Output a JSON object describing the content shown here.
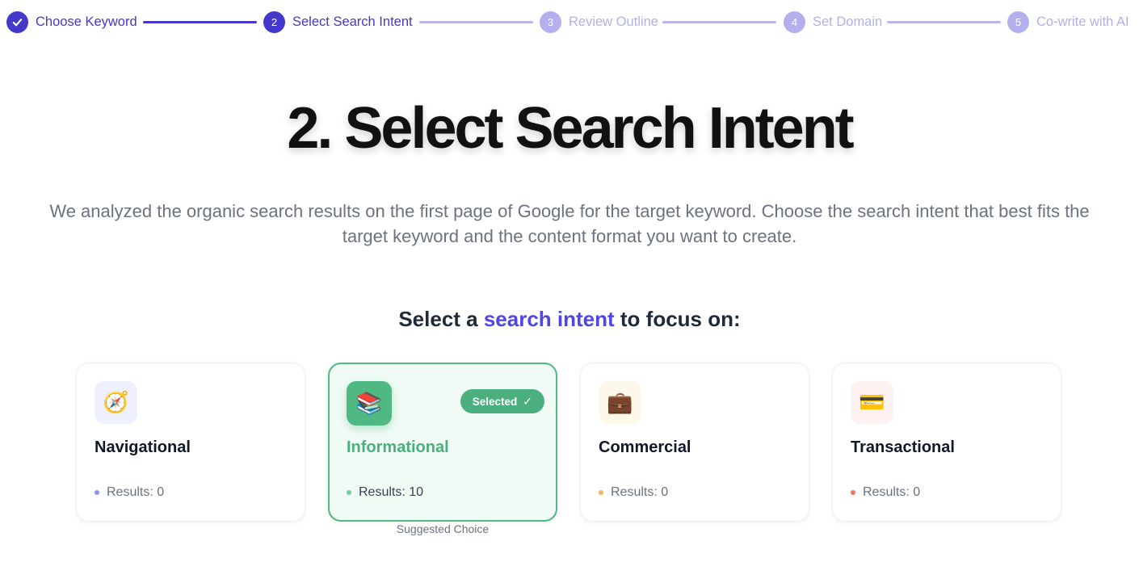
{
  "stepper": {
    "steps": [
      {
        "number": "✓",
        "label": "Choose Keyword",
        "state": "done"
      },
      {
        "number": "2",
        "label": "Select Search Intent",
        "state": "active"
      },
      {
        "number": "3",
        "label": "Review Outline",
        "state": "pending"
      },
      {
        "number": "4",
        "label": "Set Domain",
        "state": "pending"
      },
      {
        "number": "5",
        "label": "Co-write with AI",
        "state": "pending"
      }
    ]
  },
  "page": {
    "title": "2. Select Search Intent",
    "description": "We analyzed the organic search results on the first page of Google for the target keyword. Choose the search intent that best fits the target keyword and the content format you want to create.",
    "subheading_prefix": "Select a ",
    "subheading_accent": "search intent",
    "subheading_suffix": " to focus on:"
  },
  "intents": [
    {
      "name": "Navigational",
      "icon": "compass-icon",
      "icon_glyph": "🧭",
      "icon_bg": "#eef0fd",
      "results": "Results: 0",
      "dot_color": "#8b93ef",
      "selected": false
    },
    {
      "name": "Informational",
      "icon": "books-icon",
      "icon_glyph": "📚",
      "icon_bg": "#4fb883",
      "results": "Results: 10",
      "dot_color": "#6fd0a0",
      "selected": true,
      "badge": "Selected",
      "badge_check": "✓",
      "note": "Suggested Choice"
    },
    {
      "name": "Commercial",
      "icon": "briefcase-icon",
      "icon_glyph": "💼",
      "icon_bg": "#fdf8ea",
      "results": "Results: 0",
      "dot_color": "#f2b660",
      "selected": false
    },
    {
      "name": "Transactional",
      "icon": "credit-card-icon",
      "icon_glyph": "💳",
      "icon_bg": "#fdf1f1",
      "results": "Results: 0",
      "dot_color": "#ec7468",
      "selected": false
    }
  ],
  "colors": {
    "accent": "#4338ca",
    "accent_light": "#b4b0ee",
    "selected_green": "#4caf7f"
  }
}
